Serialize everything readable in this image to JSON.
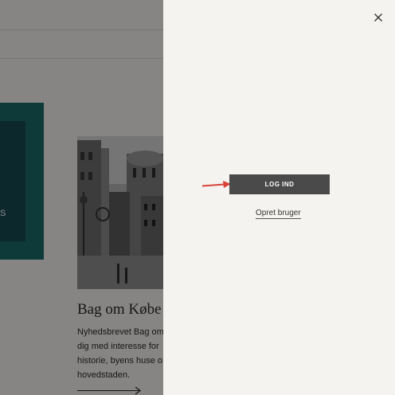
{
  "background_page": {
    "teal_card_text": "S",
    "article": {
      "title": "Bag om Købe",
      "body_lines": [
        "Nyhedsbrevet Bag om",
        "dig med interesse for",
        "historie, byens huse o",
        "hovedstaden."
      ]
    }
  },
  "login_panel": {
    "login_button_label": "LOG IND",
    "create_user_label": "Opret bruger"
  },
  "colors": {
    "teal_outer": "#1b6a6a",
    "teal_inner": "#164a52",
    "button_bg": "#4a4a4a",
    "annotation_arrow": "#d8423a"
  }
}
